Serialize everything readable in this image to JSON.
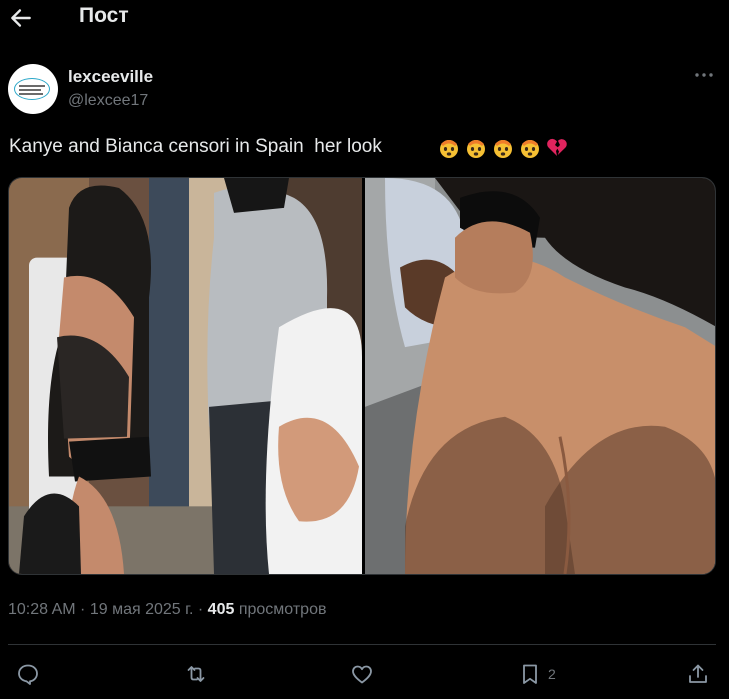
{
  "header": {
    "title": "Пост"
  },
  "post": {
    "display_name": "lexceeville",
    "handle": "@lexcee17",
    "text": "Kanye and Bianca censori in Spain  her look",
    "emojis": [
      "exploding-head",
      "exploding-head",
      "exploding-head",
      "exploding-head",
      "broken-heart"
    ],
    "time": "10:28 AM",
    "date": "19 мая 2025 г.",
    "views_count": "405",
    "views_label": "просмотров",
    "bookmark_count": "2"
  },
  "colors": {
    "background": "#000000",
    "text_primary": "#e7e9ea",
    "text_secondary": "#71767b",
    "divider": "#2f3336"
  }
}
